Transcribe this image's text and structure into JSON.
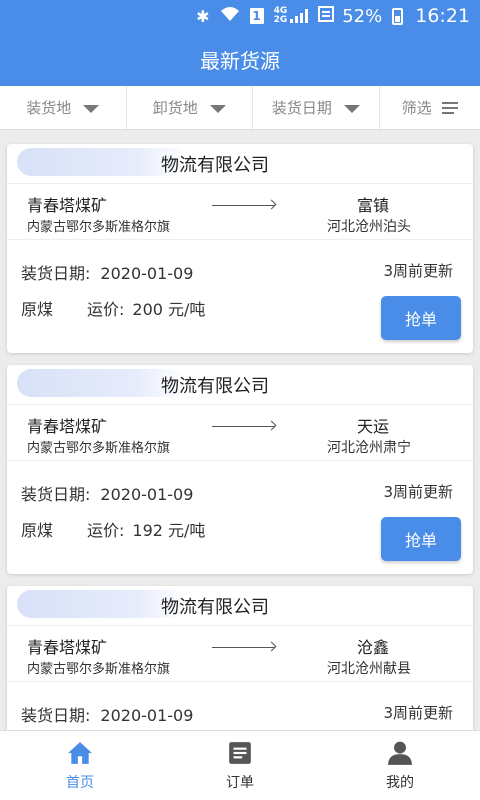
{
  "status_bar": {
    "battery_pct": "52%",
    "time": "16:21",
    "sim_label": "1",
    "network_top": "4G",
    "network_bottom": "2G",
    "icons": [
      "bluetooth-icon",
      "wifi-icon",
      "sim-icon",
      "signal-icon",
      "data-saver-icon",
      "battery-icon"
    ]
  },
  "header": {
    "title": "最新货源"
  },
  "filters": {
    "load_place": "装货地",
    "unload_place": "卸货地",
    "load_date": "装货日期",
    "filter": "筛选"
  },
  "cards": [
    {
      "company": "物流有限公司",
      "from_name": "青春塔煤矿",
      "from_place": "内蒙古鄂尔多斯准格尔旗",
      "to_name": "富镇",
      "to_place": "河北沧州泊头",
      "date_label": "装货日期:",
      "date": "2020-01-09",
      "updated": "3周前更新",
      "goods": "原煤",
      "freight_label": "运价:",
      "freight": "200 元/吨",
      "action": "抢单"
    },
    {
      "company": "物流有限公司",
      "from_name": "青春塔煤矿",
      "from_place": "内蒙古鄂尔多斯准格尔旗",
      "to_name": "天运",
      "to_place": "河北沧州肃宁",
      "date_label": "装货日期:",
      "date": "2020-01-09",
      "updated": "3周前更新",
      "goods": "原煤",
      "freight_label": "运价:",
      "freight": "192 元/吨",
      "action": "抢单"
    },
    {
      "company": "物流有限公司",
      "from_name": "青春塔煤矿",
      "from_place": "内蒙古鄂尔多斯准格尔旗",
      "to_name": "沧鑫",
      "to_place": "河北沧州献县",
      "date_label": "装货日期:",
      "date": "2020-01-09",
      "updated": "3周前更新"
    }
  ],
  "tabs": [
    {
      "label": "首页",
      "icon": "home-icon",
      "active": true
    },
    {
      "label": "订单",
      "icon": "orders-icon",
      "active": false
    },
    {
      "label": "我的",
      "icon": "profile-icon",
      "active": false
    }
  ],
  "colors": {
    "primary": "#4a8de8",
    "background": "#ececec"
  }
}
